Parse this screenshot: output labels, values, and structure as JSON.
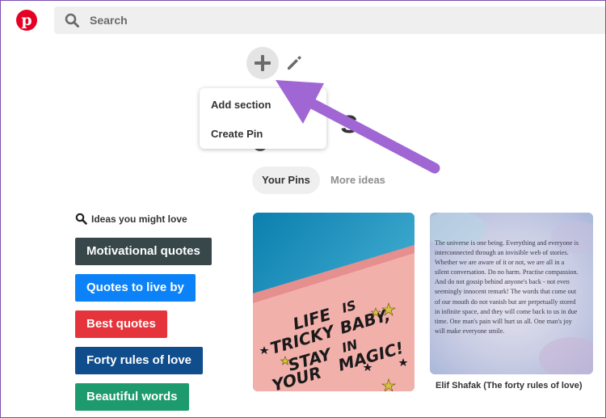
{
  "header": {
    "logo_letter": "p",
    "search_placeholder": "Search"
  },
  "board": {
    "title_fragment": "s",
    "brand_color": "#e60023"
  },
  "add_menu": {
    "items": [
      {
        "label": "Add section"
      },
      {
        "label": "Create Pin"
      }
    ]
  },
  "tabs": [
    {
      "label": "Your Pins",
      "active": true
    },
    {
      "label": "More ideas",
      "active": false
    }
  ],
  "ideas": {
    "title": "Ideas you might love",
    "chips": [
      {
        "label": "Motivational quotes",
        "color": "#37474a"
      },
      {
        "label": "Quotes to live by",
        "color": "#0c82f8"
      },
      {
        "label": "Best quotes",
        "color": "#e5343b"
      },
      {
        "label": "Forty rules of love",
        "color": "#0f4d8c"
      },
      {
        "label": "Beautiful words",
        "color": "#1d9b6e"
      }
    ]
  },
  "pins": [
    {
      "wall_text": [
        "LIFE",
        "IS",
        "TRICKY",
        "BABY,",
        "STAY",
        "IN",
        "YOUR",
        "MAGIC!"
      ]
    },
    {
      "quote_lines": [
        "The universe is one being. Everything and everyone is",
        "interconnected through an invisible web of stories.",
        "Whether we are aware of it or not, we are all in a",
        "silent conversation. Do no harm. Practise compassion.",
        "And do not gossip behind anyone's back - not even",
        "seemingly innocent remark! The words that come out",
        "of our mouth do not vanish but are perpetually stored",
        "in infinite space, and they will come back to us in due",
        "time. One man's pain will hurt us all. One man's joy",
        "will make everyone smile."
      ],
      "caption": "Elif Shafak (The forty rules of love)"
    }
  ],
  "annotation": {
    "arrow_color": "#a067d4"
  }
}
